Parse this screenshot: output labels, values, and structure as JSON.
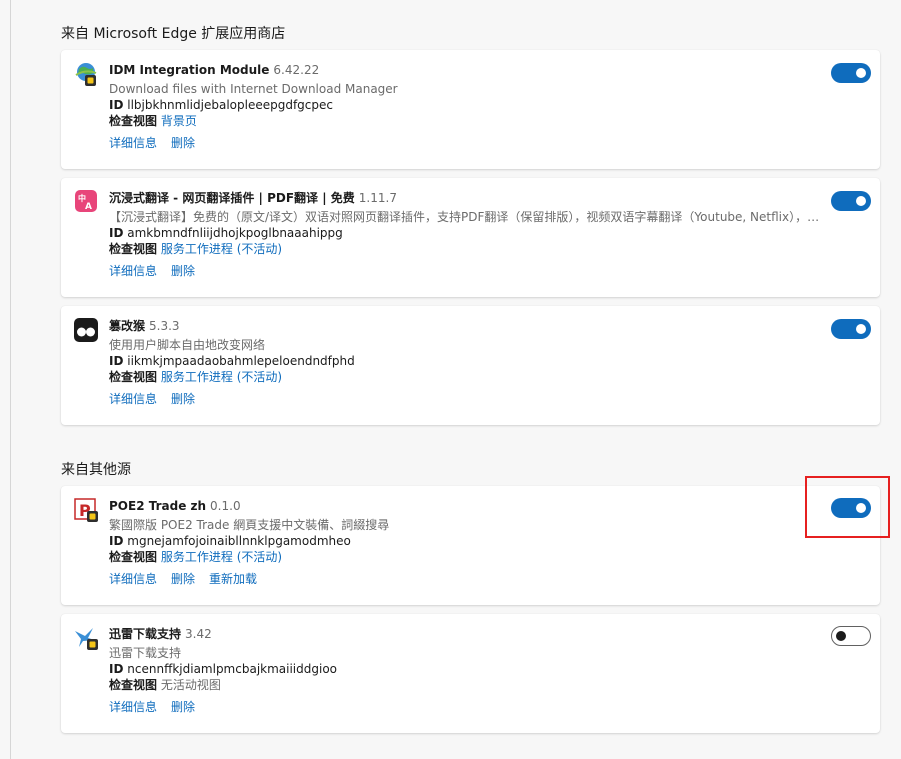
{
  "sections": {
    "store_title": "来自 Microsoft Edge 扩展应用商店",
    "other_title": "来自其他源"
  },
  "labels": {
    "id": "ID",
    "inspect": "检查视图",
    "details": "详细信息",
    "remove": "删除",
    "reload": "重新加载"
  },
  "extensions": [
    {
      "name": "IDM Integration Module",
      "version": "6.42.22",
      "description": "Download files with Internet Download Manager",
      "id": "llbjbkhnmlidjebalopleeepgdfgcpec",
      "inspect_link": "背景页",
      "inspect_suffix": "",
      "enabled": true,
      "icon": "idm-globe-icon"
    },
    {
      "name": "沉浸式翻译 - 网页翻译插件 | PDF翻译 | 免费",
      "version": "1.11.7",
      "description": "【沉浸式翻译】免费的（原文/译文）双语对照网页翻译插件，支持PDF翻译（保留排版），视频双语字幕翻译（Youtube, Netflix），…",
      "id": "amkbmndfnliijdhojkpoglbnaaahippg",
      "inspect_link": "服务工作进程",
      "inspect_suffix": "(不活动)",
      "enabled": true,
      "icon": "immersive-translate-icon"
    },
    {
      "name": "篡改猴",
      "version": "5.3.3",
      "description": "使用用户脚本自由地改变网络",
      "id": "iikmkjmpaadaobahmlepeloendndfphd",
      "inspect_link": "服务工作进程",
      "inspect_suffix": "(不活动)",
      "enabled": true,
      "icon": "tampermonkey-icon"
    },
    {
      "name": "POE2 Trade zh",
      "version": "0.1.0",
      "description": "繁國際版 POE2 Trade 網頁支援中文裝備、詞綴搜尋",
      "id": "mgnejamfojoinaibllnnklpgamodmheo",
      "inspect_link": "服务工作进程",
      "inspect_suffix": "(不活动)",
      "enabled": true,
      "icon": "poe-p-icon"
    },
    {
      "name": "迅雷下载支持",
      "version": "3.42",
      "description": "迅雷下载支持",
      "id": "ncennffkjdiamlpmcbajkmaiiiddgioo",
      "inspect_link": "",
      "inspect_text": "无活动视图",
      "enabled": false,
      "icon": "thunder-bird-icon"
    }
  ],
  "colors": {
    "accent": "#0f6cbd",
    "highlight": "#e62020"
  }
}
